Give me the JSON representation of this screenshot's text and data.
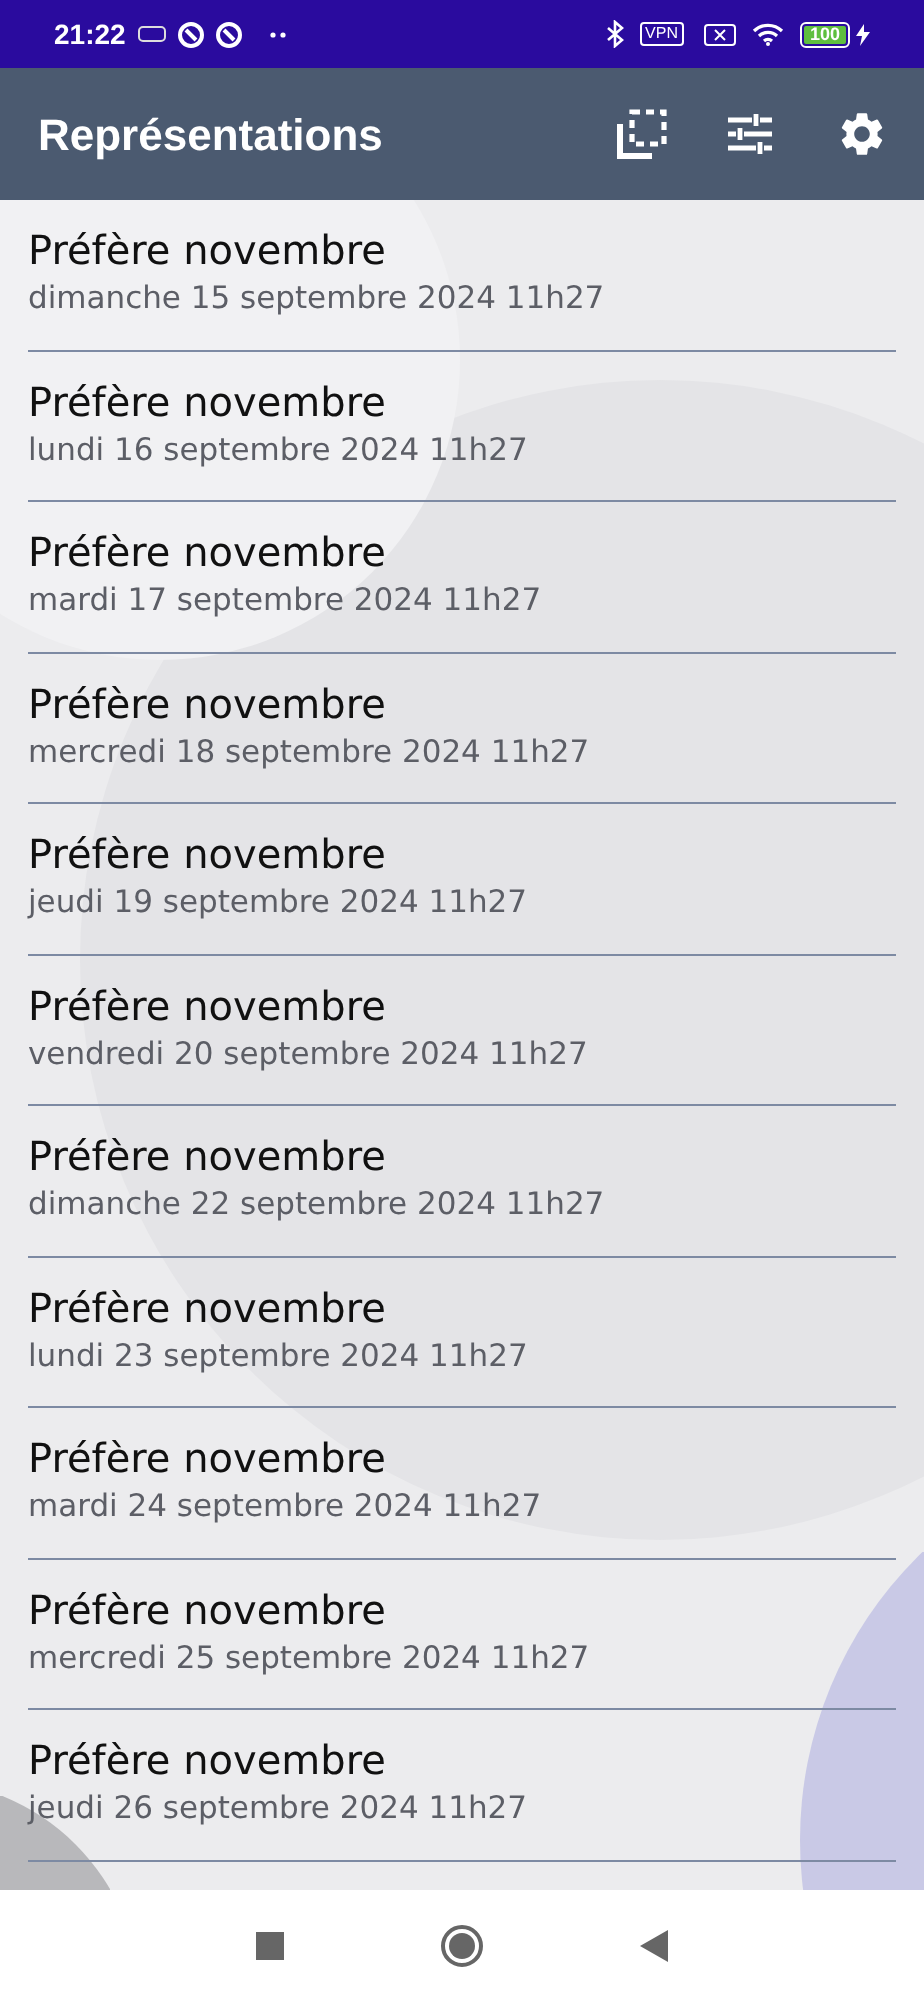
{
  "status_bar": {
    "time": "21:22",
    "vpn": "VPN",
    "battery": "100"
  },
  "app_bar": {
    "title": "Représentations"
  },
  "items": [
    {
      "title": "Préfère novembre",
      "date": "dimanche 15 septembre 2024 11h27"
    },
    {
      "title": "Préfère novembre",
      "date": "lundi 16 septembre 2024 11h27"
    },
    {
      "title": "Préfère novembre",
      "date": "mardi 17 septembre 2024 11h27"
    },
    {
      "title": "Préfère novembre",
      "date": "mercredi 18 septembre 2024 11h27"
    },
    {
      "title": "Préfère novembre",
      "date": "jeudi 19 septembre 2024 11h27"
    },
    {
      "title": "Préfère novembre",
      "date": "vendredi 20 septembre 2024 11h27"
    },
    {
      "title": "Préfère novembre",
      "date": "dimanche 22 septembre 2024 11h27"
    },
    {
      "title": "Préfère novembre",
      "date": "lundi 23 septembre 2024 11h27"
    },
    {
      "title": "Préfère novembre",
      "date": "mardi 24 septembre 2024 11h27"
    },
    {
      "title": "Préfère novembre",
      "date": "mercredi 25 septembre 2024 11h27"
    },
    {
      "title": "Préfère novembre",
      "date": "jeudi 26 septembre 2024 11h27"
    }
  ]
}
